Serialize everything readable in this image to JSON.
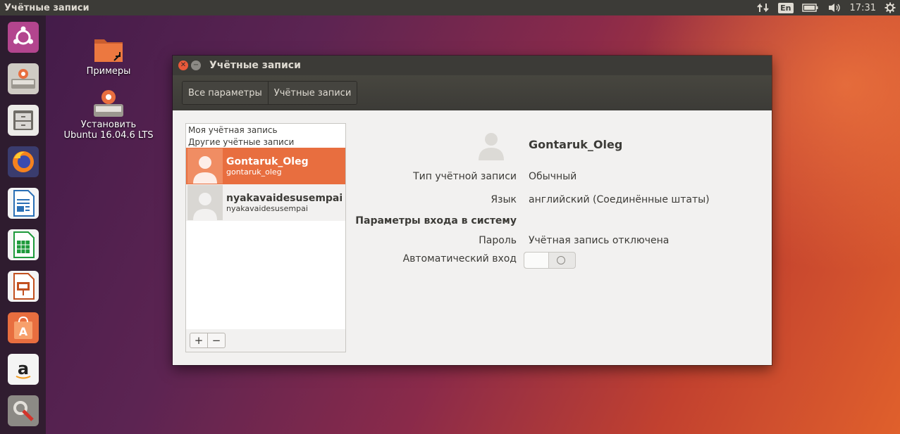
{
  "topbar": {
    "app_title": "Учётные записи",
    "keyboard_layout": "En",
    "time": "17:31"
  },
  "launcher": {
    "items": [
      "ubuntu-dash-icon",
      "install-ubuntu-icon",
      "files-icon",
      "firefox-icon",
      "libreoffice-writer-icon",
      "libreoffice-calc-icon",
      "libreoffice-impress-icon",
      "software-center-icon",
      "amazon-icon",
      "system-settings-icon"
    ]
  },
  "desktop": {
    "icons": [
      {
        "label": "Примеры"
      },
      {
        "label_line1": "Установить",
        "label_line2": "Ubuntu 16.04.6 LTS"
      }
    ]
  },
  "window": {
    "title": "Учётные записи",
    "breadcrumbs": [
      "Все параметры",
      "Учётные записи"
    ],
    "list": {
      "my_account_header": "Моя учётная запись",
      "other_accounts_header": "Другие учётные записи",
      "users": [
        {
          "name": "Gontaruk_Oleg",
          "login": "gontaruk_oleg",
          "selected": true
        },
        {
          "name": "nyakavaidesusempai",
          "login": "nyakavaidesusempai",
          "selected": false
        }
      ],
      "add_label": "+",
      "remove_label": "−"
    },
    "details": {
      "name": "Gontaruk_Oleg",
      "account_type_label": "Тип учётной записи",
      "account_type_value": "Обычный",
      "language_label": "Язык",
      "language_value": "английский (Соединённые штаты)",
      "login_section": "Параметры входа в систему",
      "password_label": "Пароль",
      "password_value": "Учётная запись отключена",
      "autologin_label": "Автоматический вход",
      "autologin_on": false
    }
  },
  "colors": {
    "accent": "#e86e3f",
    "panel": "#3c3b37"
  }
}
